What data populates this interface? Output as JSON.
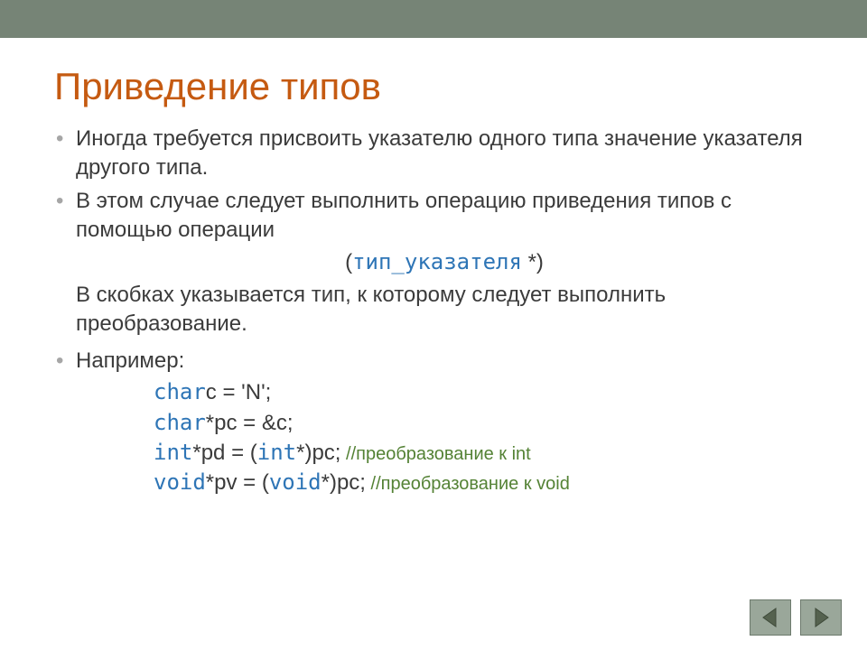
{
  "title": "Приведение типов",
  "bullets": {
    "b1": "Иногда требуется присвоить указателю одного типа значение указателя другого типа.",
    "b2": "В этом случае следует выполнить операцию приведения типов с помощью операции",
    "b3": "Например:"
  },
  "syntax": {
    "open": "(",
    "kw": "тип_указателя",
    "close": " *)"
  },
  "explain": "В скобках указывается тип, к которому следует выполнить преобразование.",
  "code": {
    "l1_kw": "char",
    "l1_rest": "c = 'N';",
    "l2_kw": "char",
    "l2_rest": "*pc = &c;",
    "l3_kw": "int",
    "l3_mid": "*pd = (",
    "l3_kw2": "int",
    "l3_rest": "*)pc;",
    "l3_cmt": " //преобразование к int",
    "l4_kw": "void",
    "l4_mid": "*pv = (",
    "l4_kw2": "void",
    "l4_rest": "*)pc;",
    "l4_cmt": " //преобразование к void"
  },
  "nav": {
    "prev": "previous-slide",
    "next": "next-slide"
  }
}
